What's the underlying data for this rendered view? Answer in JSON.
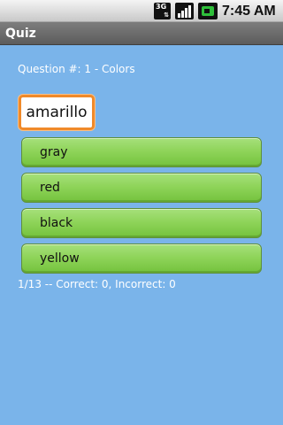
{
  "status_bar": {
    "network": "3G",
    "time": "7:45 AM",
    "icons": [
      "network-3g-icon",
      "signal-strength-icon",
      "battery-icon"
    ]
  },
  "app": {
    "title": "Quiz"
  },
  "quiz": {
    "question_label": "Question #: 1 - Colors",
    "word": "amarillo",
    "answers": [
      "gray",
      "red",
      "black",
      "yellow"
    ],
    "score": "1/13 -- Correct: 0, Incorrect: 0"
  },
  "colors": {
    "background": "#7ab4ea",
    "answer_button": "#8fd45a",
    "word_border": "#f08a2a",
    "title_bar": "#6b6b6b"
  }
}
